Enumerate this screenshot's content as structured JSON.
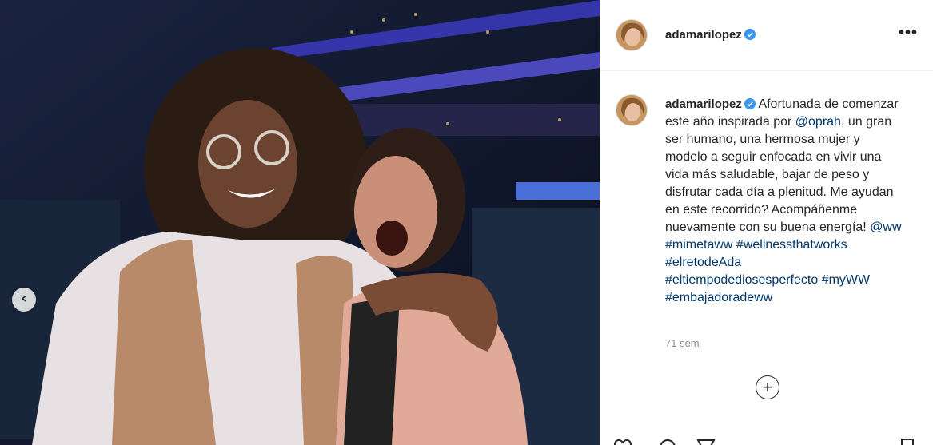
{
  "post": {
    "photo": {
      "description_icon": "photo-icon",
      "prev_icon": "chevron-left-icon",
      "prev_glyph": "‹"
    },
    "header": {
      "username": "adamarilopez",
      "verified_icon": "verified-badge-icon",
      "more_label": "•••"
    },
    "caption": {
      "username": "adamarilopez",
      "text_before": " Afortunada de comenzar este año inspirada por ",
      "mention_oprah": "@oprah",
      "text_middle": ", un gran ser humano, una hermosa mujer y modelo a seguir enfocada en vivir una vida más saludable, bajar de peso y disfrutar cada día a plenitud. Me ayudan en este recorrido? Acompáñenme nuevamente con su buena energía! ",
      "mention_ww": "@ww",
      "hashtags": [
        "#mimetaww",
        "#wellnessthatworks",
        "#elretodeAda",
        "#eltiempodediosesperfecto",
        "#myWW",
        "#embajadoradeww"
      ]
    },
    "timestamp": "71 sem",
    "add_comment_glyph": "+",
    "colors": {
      "link": "#00376b",
      "verified": "#3897f0",
      "muted": "#8e8e8e",
      "text": "#262626"
    }
  }
}
